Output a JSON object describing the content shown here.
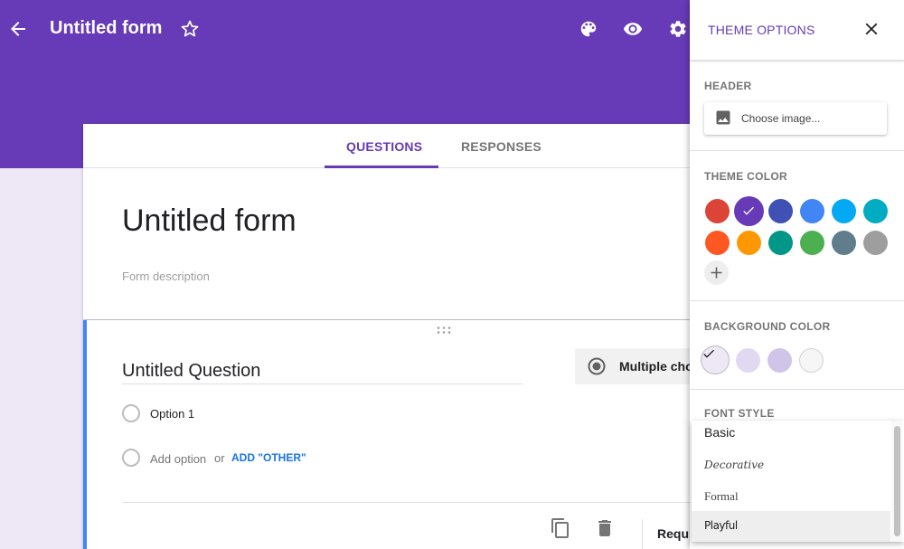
{
  "app": {
    "title": "Untitled form",
    "colors": {
      "theme": "#673ab7",
      "background": "#ede7f6",
      "accent_link": "#1a73e8"
    }
  },
  "topbar": {
    "back_icon": "arrow-back-icon",
    "star_icon": "star-outline-icon",
    "actions": [
      {
        "name": "palette-icon",
        "label": "Customize theme"
      },
      {
        "name": "eye-icon",
        "label": "Preview"
      },
      {
        "name": "gear-icon",
        "label": "Settings"
      }
    ]
  },
  "tabs": [
    {
      "label": "QUESTIONS",
      "active": true
    },
    {
      "label": "RESPONSES",
      "active": false
    }
  ],
  "form": {
    "title": "Untitled form",
    "description_placeholder": "Form description"
  },
  "question": {
    "title": "Untitled Question",
    "type": "Multiple choice",
    "type_visible": "Multiple cho",
    "options": [
      "Option 1"
    ],
    "add_option": "Add option",
    "or": "or",
    "add_other": "ADD \"OTHER\"",
    "required_label": "Requi",
    "footer_icons": [
      "duplicate-icon",
      "delete-icon"
    ]
  },
  "theme_panel": {
    "title": "THEME OPTIONS",
    "close_icon": "close-icon",
    "header_section": {
      "label": "HEADER",
      "choose_image": "Choose image..."
    },
    "theme_color": {
      "label": "THEME COLOR",
      "swatches": [
        "#db4437",
        "#673ab7",
        "#3f51b5",
        "#4285f4",
        "#03a9f4",
        "#00acc1",
        "#ff5722",
        "#ff9800",
        "#009688",
        "#4caf50",
        "#607d8b",
        "#9e9e9e"
      ],
      "selected_index": 1,
      "add_custom": "+"
    },
    "background_color": {
      "label": "BACKGROUND COLOR",
      "swatches": [
        "#ede7f6",
        "#e1d8f1",
        "#d1c4e9",
        "#f6f6f6"
      ],
      "selected_index": 0
    },
    "font_style": {
      "label": "FONT STYLE",
      "options": [
        "Basic",
        "Decorative",
        "Formal",
        "Playful"
      ],
      "highlighted": "Playful"
    }
  }
}
